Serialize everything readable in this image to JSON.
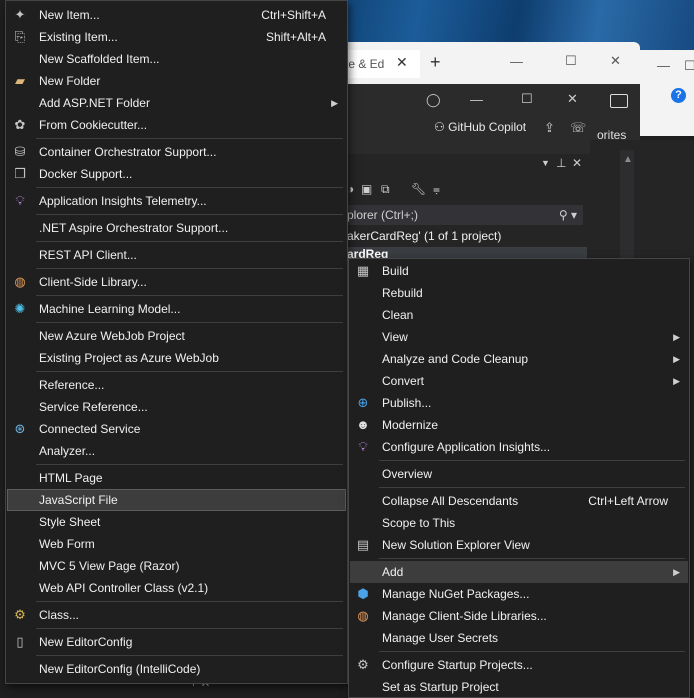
{
  "browser": {
    "tab_title": "te & Ed",
    "close": "✕",
    "plus": "+",
    "minimize": "—",
    "maximize": "☐",
    "close_window": "✕"
  },
  "vs": {
    "copilot_label": "GitHub Copilot",
    "favorites": "orites",
    "solution_explorer_search": "plorer (Ctrl+;)",
    "solution_tree_item": "akerCardReg' (1 of 1 project)",
    "project_node": "ardReg"
  },
  "add_menu": {
    "items": [
      {
        "label": "New Item...",
        "shortcut": "Ctrl+Shift+A",
        "icon": "new-item-icon"
      },
      {
        "label": "Existing Item...",
        "shortcut": "Shift+Alt+A",
        "icon": "existing-item-icon"
      },
      {
        "label": "New Scaffolded Item...",
        "shortcut": "",
        "icon": ""
      },
      {
        "label": "New Folder",
        "shortcut": "",
        "icon": "folder-icon"
      },
      {
        "label": "Add ASP.NET Folder",
        "shortcut": "",
        "icon": "",
        "submenu": true
      },
      {
        "label": "From Cookiecutter...",
        "shortcut": "",
        "icon": "cookiecutter-icon"
      },
      {
        "label": "Container Orchestrator Support...",
        "shortcut": "",
        "icon": "container-icon"
      },
      {
        "label": "Docker Support...",
        "shortcut": "",
        "icon": "docker-icon"
      },
      {
        "label": "Application Insights Telemetry...",
        "shortcut": "",
        "icon": "app-insights-icon"
      },
      {
        "label": ".NET Aspire Orchestrator Support...",
        "shortcut": "",
        "icon": ""
      },
      {
        "label": "REST API Client...",
        "shortcut": "",
        "icon": ""
      },
      {
        "label": "Client-Side Library...",
        "shortcut": "",
        "icon": "client-library-icon"
      },
      {
        "label": "Machine Learning Model...",
        "shortcut": "",
        "icon": "ml-model-icon"
      },
      {
        "label": "New Azure WebJob Project",
        "shortcut": "",
        "icon": ""
      },
      {
        "label": "Existing Project as Azure WebJob",
        "shortcut": "",
        "icon": ""
      },
      {
        "label": "Reference...",
        "shortcut": "",
        "icon": ""
      },
      {
        "label": "Service Reference...",
        "shortcut": "",
        "icon": ""
      },
      {
        "label": "Connected Service",
        "shortcut": "",
        "icon": "connected-service-icon"
      },
      {
        "label": "Analyzer...",
        "shortcut": "",
        "icon": ""
      },
      {
        "label": "HTML Page",
        "shortcut": "",
        "icon": ""
      },
      {
        "label": "JavaScript File",
        "shortcut": "",
        "icon": ""
      },
      {
        "label": "Style Sheet",
        "shortcut": "",
        "icon": ""
      },
      {
        "label": "Web Form",
        "shortcut": "",
        "icon": ""
      },
      {
        "label": "MVC 5 View Page (Razor)",
        "shortcut": "",
        "icon": ""
      },
      {
        "label": "Web API Controller Class (v2.1)",
        "shortcut": "",
        "icon": ""
      },
      {
        "label": "Class...",
        "shortcut": "",
        "icon": "class-icon"
      },
      {
        "label": "New EditorConfig",
        "shortcut": "",
        "icon": "editorconfig-icon"
      },
      {
        "label": "New EditorConfig (IntelliCode)",
        "shortcut": "",
        "icon": ""
      }
    ]
  },
  "context_menu": {
    "items": [
      {
        "label": "Build",
        "shortcut": "",
        "icon": "build-icon"
      },
      {
        "label": "Rebuild",
        "shortcut": "",
        "icon": ""
      },
      {
        "label": "Clean",
        "shortcut": "",
        "icon": ""
      },
      {
        "label": "View",
        "shortcut": "",
        "icon": "",
        "submenu": true
      },
      {
        "label": "Analyze and Code Cleanup",
        "shortcut": "",
        "icon": "",
        "submenu": true
      },
      {
        "label": "Convert",
        "shortcut": "",
        "icon": "",
        "submenu": true
      },
      {
        "label": "Publish...",
        "shortcut": "",
        "icon": "publish-globe-icon"
      },
      {
        "label": "Modernize",
        "shortcut": "",
        "icon": "modernize-icon"
      },
      {
        "label": "Configure Application Insights...",
        "shortcut": "",
        "icon": "app-insights-icon"
      },
      {
        "label": "Overview",
        "shortcut": "",
        "icon": ""
      },
      {
        "label": "Collapse All Descendants",
        "shortcut": "Ctrl+Left Arrow",
        "icon": ""
      },
      {
        "label": "Scope to This",
        "shortcut": "",
        "icon": ""
      },
      {
        "label": "New Solution Explorer View",
        "shortcut": "",
        "icon": "solution-explorer-view-icon"
      },
      {
        "label": "Add",
        "shortcut": "",
        "icon": "",
        "submenu": true
      },
      {
        "label": "Manage NuGet Packages...",
        "shortcut": "",
        "icon": "nuget-icon"
      },
      {
        "label": "Manage Client-Side Libraries...",
        "shortcut": "",
        "icon": "client-library-icon"
      },
      {
        "label": "Manage User Secrets",
        "shortcut": "",
        "icon": ""
      },
      {
        "label": "Configure Startup Projects...",
        "shortcut": "",
        "icon": "gear-icon"
      },
      {
        "label": "Set as Startup Project",
        "shortcut": "",
        "icon": ""
      }
    ]
  }
}
